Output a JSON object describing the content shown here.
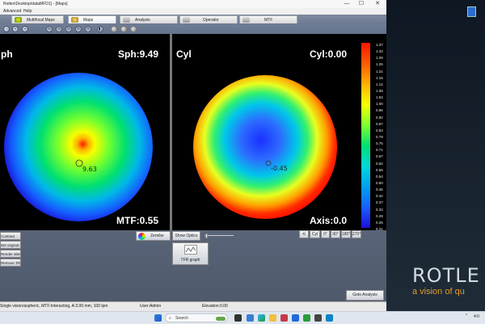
{
  "window": {
    "title": "Rotlex\\Desktop\\dataMFD1] - [Maps]",
    "minimize": "—",
    "maximize": "☐",
    "close": "✕"
  },
  "menu": [
    "Advanced",
    "Help"
  ],
  "tabs": [
    {
      "label": "Multifocal Maps",
      "icon_color": "#f2c400"
    },
    {
      "label": "Maps",
      "icon_color": "#c9a23a"
    },
    {
      "label": "Analysis",
      "icon_color": "#9a9a9a"
    },
    {
      "label": "Operator",
      "icon_color": "#9a9a9a"
    },
    {
      "label": "MTF",
      "icon_color": "#9a9a9a"
    }
  ],
  "toolbar_icons": [
    "zoom-out-icon",
    "zoom-in-icon",
    "zoom-reset-icon",
    "tool-1-icon",
    "tool-2-icon",
    "tool-3-icon",
    "tool-4-icon",
    "tool-5-icon",
    "tool-6-icon",
    "tool-7-icon",
    "stop-icon",
    "play-icon",
    "record-icon"
  ],
  "sph_panel": {
    "title": "ph",
    "value_label": "Sph:9.49",
    "center_value": "9.63",
    "mtf_label": "MTF:0.55"
  },
  "cyl_panel": {
    "title": "Cyl",
    "value_label": "Cyl:0.00",
    "center_value": "-0.45",
    "axis_label": "Axis:0.0"
  },
  "scale": [
    "1.37",
    "1.33",
    "1.29",
    "1.25",
    "1.21",
    "1.16",
    "1.12",
    "1.08",
    "1.04",
    "1.00",
    "0.96",
    "0.92",
    "0.87",
    "0.83",
    "0.79",
    "0.75",
    "0.71",
    "0.67",
    "0.62",
    "0.58",
    "0.54",
    "0.50",
    "0.46",
    "0.42",
    "0.37",
    "0.33",
    "0.29",
    "0.25",
    "0.21"
  ],
  "left_buttons": [
    "Contrast",
    "Set original",
    "Render abers",
    "Remove Tilt"
  ],
  "zernike_label": "Zernike",
  "show_optics_label": "Show Optics",
  "tfr_graph_label": "TFR graph",
  "axis_buttons": [
    "Cyl",
    "0°",
    "90°",
    "180°",
    "270°"
  ],
  "goto_analysis_label": "Goto Analysis",
  "status": {
    "mode": "Single vision/aspheric, MTF:Interacting, A:3.00 mm, 100 lpm",
    "user": "User:Admin",
    "elevation": "Elevation:0.00"
  },
  "desktop": {
    "brand": "ROTLE",
    "tagline": "a vision of qu"
  },
  "taskbar": {
    "search_placeholder": "Search",
    "time": "4:0"
  },
  "colors": {
    "tab_bar": "#6c7a91",
    "bottom_panel": "#545e72",
    "map_bg": "#000000"
  }
}
